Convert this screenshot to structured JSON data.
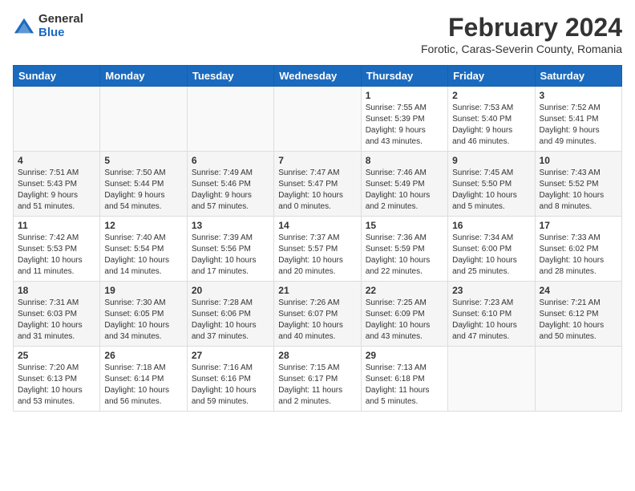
{
  "logo": {
    "general": "General",
    "blue": "Blue"
  },
  "title": "February 2024",
  "subtitle": "Forotic, Caras-Severin County, Romania",
  "headers": [
    "Sunday",
    "Monday",
    "Tuesday",
    "Wednesday",
    "Thursday",
    "Friday",
    "Saturday"
  ],
  "weeks": [
    [
      {
        "day": "",
        "info": ""
      },
      {
        "day": "",
        "info": ""
      },
      {
        "day": "",
        "info": ""
      },
      {
        "day": "",
        "info": ""
      },
      {
        "day": "1",
        "info": "Sunrise: 7:55 AM\nSunset: 5:39 PM\nDaylight: 9 hours\nand 43 minutes."
      },
      {
        "day": "2",
        "info": "Sunrise: 7:53 AM\nSunset: 5:40 PM\nDaylight: 9 hours\nand 46 minutes."
      },
      {
        "day": "3",
        "info": "Sunrise: 7:52 AM\nSunset: 5:41 PM\nDaylight: 9 hours\nand 49 minutes."
      }
    ],
    [
      {
        "day": "4",
        "info": "Sunrise: 7:51 AM\nSunset: 5:43 PM\nDaylight: 9 hours\nand 51 minutes."
      },
      {
        "day": "5",
        "info": "Sunrise: 7:50 AM\nSunset: 5:44 PM\nDaylight: 9 hours\nand 54 minutes."
      },
      {
        "day": "6",
        "info": "Sunrise: 7:49 AM\nSunset: 5:46 PM\nDaylight: 9 hours\nand 57 minutes."
      },
      {
        "day": "7",
        "info": "Sunrise: 7:47 AM\nSunset: 5:47 PM\nDaylight: 10 hours\nand 0 minutes."
      },
      {
        "day": "8",
        "info": "Sunrise: 7:46 AM\nSunset: 5:49 PM\nDaylight: 10 hours\nand 2 minutes."
      },
      {
        "day": "9",
        "info": "Sunrise: 7:45 AM\nSunset: 5:50 PM\nDaylight: 10 hours\nand 5 minutes."
      },
      {
        "day": "10",
        "info": "Sunrise: 7:43 AM\nSunset: 5:52 PM\nDaylight: 10 hours\nand 8 minutes."
      }
    ],
    [
      {
        "day": "11",
        "info": "Sunrise: 7:42 AM\nSunset: 5:53 PM\nDaylight: 10 hours\nand 11 minutes."
      },
      {
        "day": "12",
        "info": "Sunrise: 7:40 AM\nSunset: 5:54 PM\nDaylight: 10 hours\nand 14 minutes."
      },
      {
        "day": "13",
        "info": "Sunrise: 7:39 AM\nSunset: 5:56 PM\nDaylight: 10 hours\nand 17 minutes."
      },
      {
        "day": "14",
        "info": "Sunrise: 7:37 AM\nSunset: 5:57 PM\nDaylight: 10 hours\nand 20 minutes."
      },
      {
        "day": "15",
        "info": "Sunrise: 7:36 AM\nSunset: 5:59 PM\nDaylight: 10 hours\nand 22 minutes."
      },
      {
        "day": "16",
        "info": "Sunrise: 7:34 AM\nSunset: 6:00 PM\nDaylight: 10 hours\nand 25 minutes."
      },
      {
        "day": "17",
        "info": "Sunrise: 7:33 AM\nSunset: 6:02 PM\nDaylight: 10 hours\nand 28 minutes."
      }
    ],
    [
      {
        "day": "18",
        "info": "Sunrise: 7:31 AM\nSunset: 6:03 PM\nDaylight: 10 hours\nand 31 minutes."
      },
      {
        "day": "19",
        "info": "Sunrise: 7:30 AM\nSunset: 6:05 PM\nDaylight: 10 hours\nand 34 minutes."
      },
      {
        "day": "20",
        "info": "Sunrise: 7:28 AM\nSunset: 6:06 PM\nDaylight: 10 hours\nand 37 minutes."
      },
      {
        "day": "21",
        "info": "Sunrise: 7:26 AM\nSunset: 6:07 PM\nDaylight: 10 hours\nand 40 minutes."
      },
      {
        "day": "22",
        "info": "Sunrise: 7:25 AM\nSunset: 6:09 PM\nDaylight: 10 hours\nand 43 minutes."
      },
      {
        "day": "23",
        "info": "Sunrise: 7:23 AM\nSunset: 6:10 PM\nDaylight: 10 hours\nand 47 minutes."
      },
      {
        "day": "24",
        "info": "Sunrise: 7:21 AM\nSunset: 6:12 PM\nDaylight: 10 hours\nand 50 minutes."
      }
    ],
    [
      {
        "day": "25",
        "info": "Sunrise: 7:20 AM\nSunset: 6:13 PM\nDaylight: 10 hours\nand 53 minutes."
      },
      {
        "day": "26",
        "info": "Sunrise: 7:18 AM\nSunset: 6:14 PM\nDaylight: 10 hours\nand 56 minutes."
      },
      {
        "day": "27",
        "info": "Sunrise: 7:16 AM\nSunset: 6:16 PM\nDaylight: 10 hours\nand 59 minutes."
      },
      {
        "day": "28",
        "info": "Sunrise: 7:15 AM\nSunset: 6:17 PM\nDaylight: 11 hours\nand 2 minutes."
      },
      {
        "day": "29",
        "info": "Sunrise: 7:13 AM\nSunset: 6:18 PM\nDaylight: 11 hours\nand 5 minutes."
      },
      {
        "day": "",
        "info": ""
      },
      {
        "day": "",
        "info": ""
      }
    ]
  ]
}
